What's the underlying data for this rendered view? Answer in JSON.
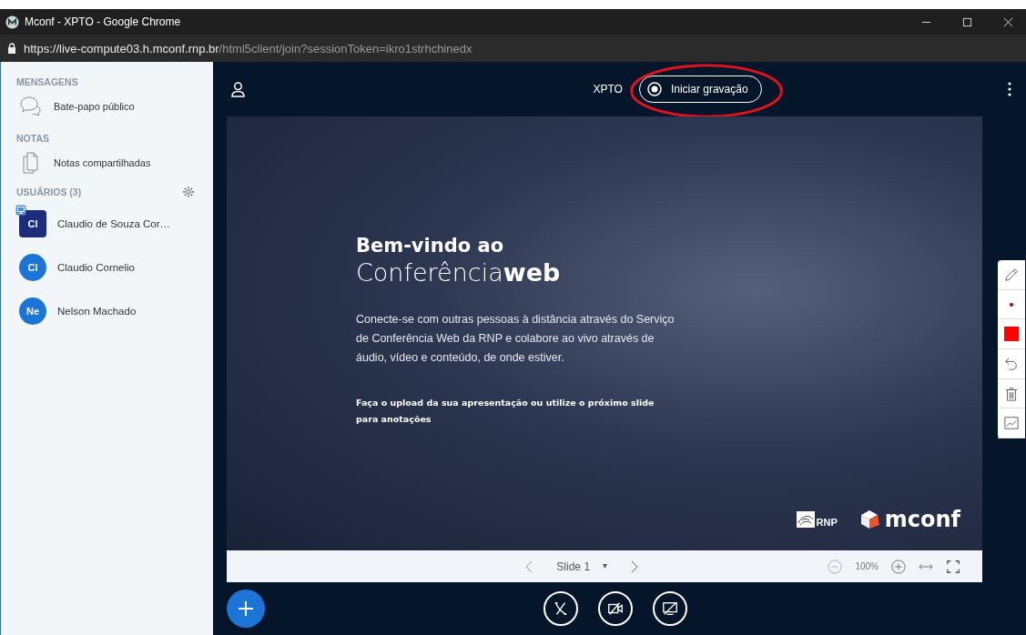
{
  "window": {
    "title": "Mconf - XPTO - Google Chrome"
  },
  "address_bar": {
    "host": "https://live-compute03.h.mconf.rnp.br",
    "path": "/html5client/join?sessionToken=ikro1strhchinedx"
  },
  "sidebar": {
    "sections": [
      {
        "title": "MENSAGENS",
        "items": [
          {
            "label": "Bate-papo público",
            "kind": "chat"
          }
        ]
      },
      {
        "title": "NOTAS",
        "items": [
          {
            "label": "Notas compartilhadas",
            "kind": "notes"
          }
        ]
      }
    ],
    "users_title": "USUÁRIOS (3)",
    "users": [
      {
        "initials": "Cl",
        "name": "Claudio de Souza Cor…",
        "moderator": true,
        "presenter": true
      },
      {
        "initials": "Cl",
        "name": "Claudio Cornelio",
        "moderator": false,
        "presenter": false
      },
      {
        "initials": "Ne",
        "name": "Nelson Machado",
        "moderator": false,
        "presenter": false
      }
    ]
  },
  "header": {
    "meeting_name": "XPTO",
    "record_button": "Iniciar gravação",
    "record_circled": true
  },
  "slide": {
    "heading": "Bem-vindo ao",
    "brand_light": "Conferência",
    "brand_bold": "web",
    "body": "Conecte-se com outras pessoas à distância através do Serviço de Conferência Web da RNP e colabore ao vivo através de áudio, vídeo e conteúdo, de onde estiver.",
    "note": "Faça o upload da sua apresentação ou utilize o próximo slide para anotações",
    "logo_rnp": "RNP",
    "logo_mconf": "mconf"
  },
  "slide_controls": {
    "current": "Slide 1",
    "dropdown": "▾",
    "zoom": "100%"
  },
  "toolbar": [
    {
      "kind": "pencil"
    },
    {
      "kind": "dot"
    },
    {
      "kind": "color",
      "color": "#ff0000"
    },
    {
      "kind": "undo"
    },
    {
      "kind": "trash"
    },
    {
      "kind": "chart"
    }
  ],
  "actions": [
    {
      "kind": "audio"
    },
    {
      "kind": "video"
    },
    {
      "kind": "screen"
    }
  ]
}
